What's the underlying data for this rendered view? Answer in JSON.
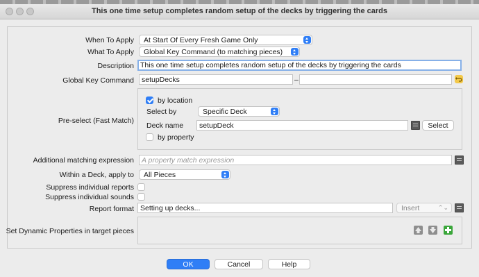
{
  "window": {
    "title": "This one time setup completes  random setup of the decks by triggering the cards"
  },
  "form": {
    "when_to_apply": {
      "label": "When To Apply",
      "value": "At Start Of Every Fresh Game Only"
    },
    "what_to_apply": {
      "label": "What To Apply",
      "value": "Global Key Command (to matching pieces)"
    },
    "description": {
      "label": "Description",
      "value": "This one time setup completes  random setup of the decks by triggering the cards"
    },
    "global_key_command": {
      "label": "Global Key Command",
      "value": "setupDecks",
      "separator": "–",
      "second_value": ""
    },
    "preselect": {
      "label": "Pre-select (Fast Match)",
      "by_location": {
        "label": "by location",
        "checked": true
      },
      "select_by": {
        "label": "Select by",
        "value": "Specific Deck"
      },
      "deck_name": {
        "label": "Deck name",
        "value": "setupDeck",
        "select_button": "Select"
      },
      "by_property": {
        "label": "by property",
        "checked": false
      }
    },
    "additional_matching": {
      "label": "Additional matching expression",
      "placeholder": "A property match expression"
    },
    "within_deck": {
      "label": "Within a Deck, apply to",
      "value": "All Pieces"
    },
    "suppress_reports": {
      "label": "Suppress individual reports",
      "checked": false
    },
    "suppress_sounds": {
      "label": "Suppress individual sounds",
      "checked": false
    },
    "report_format": {
      "label": "Report format",
      "value": "Setting up decks...",
      "insert_label": "Insert"
    },
    "dynamic_properties": {
      "label": "Set Dynamic Properties in target pieces"
    }
  },
  "buttons": {
    "ok": "OK",
    "cancel": "Cancel",
    "help": "Help"
  },
  "colors": {
    "accent": "#2f7ef6",
    "add_green": "#3aa63a"
  }
}
